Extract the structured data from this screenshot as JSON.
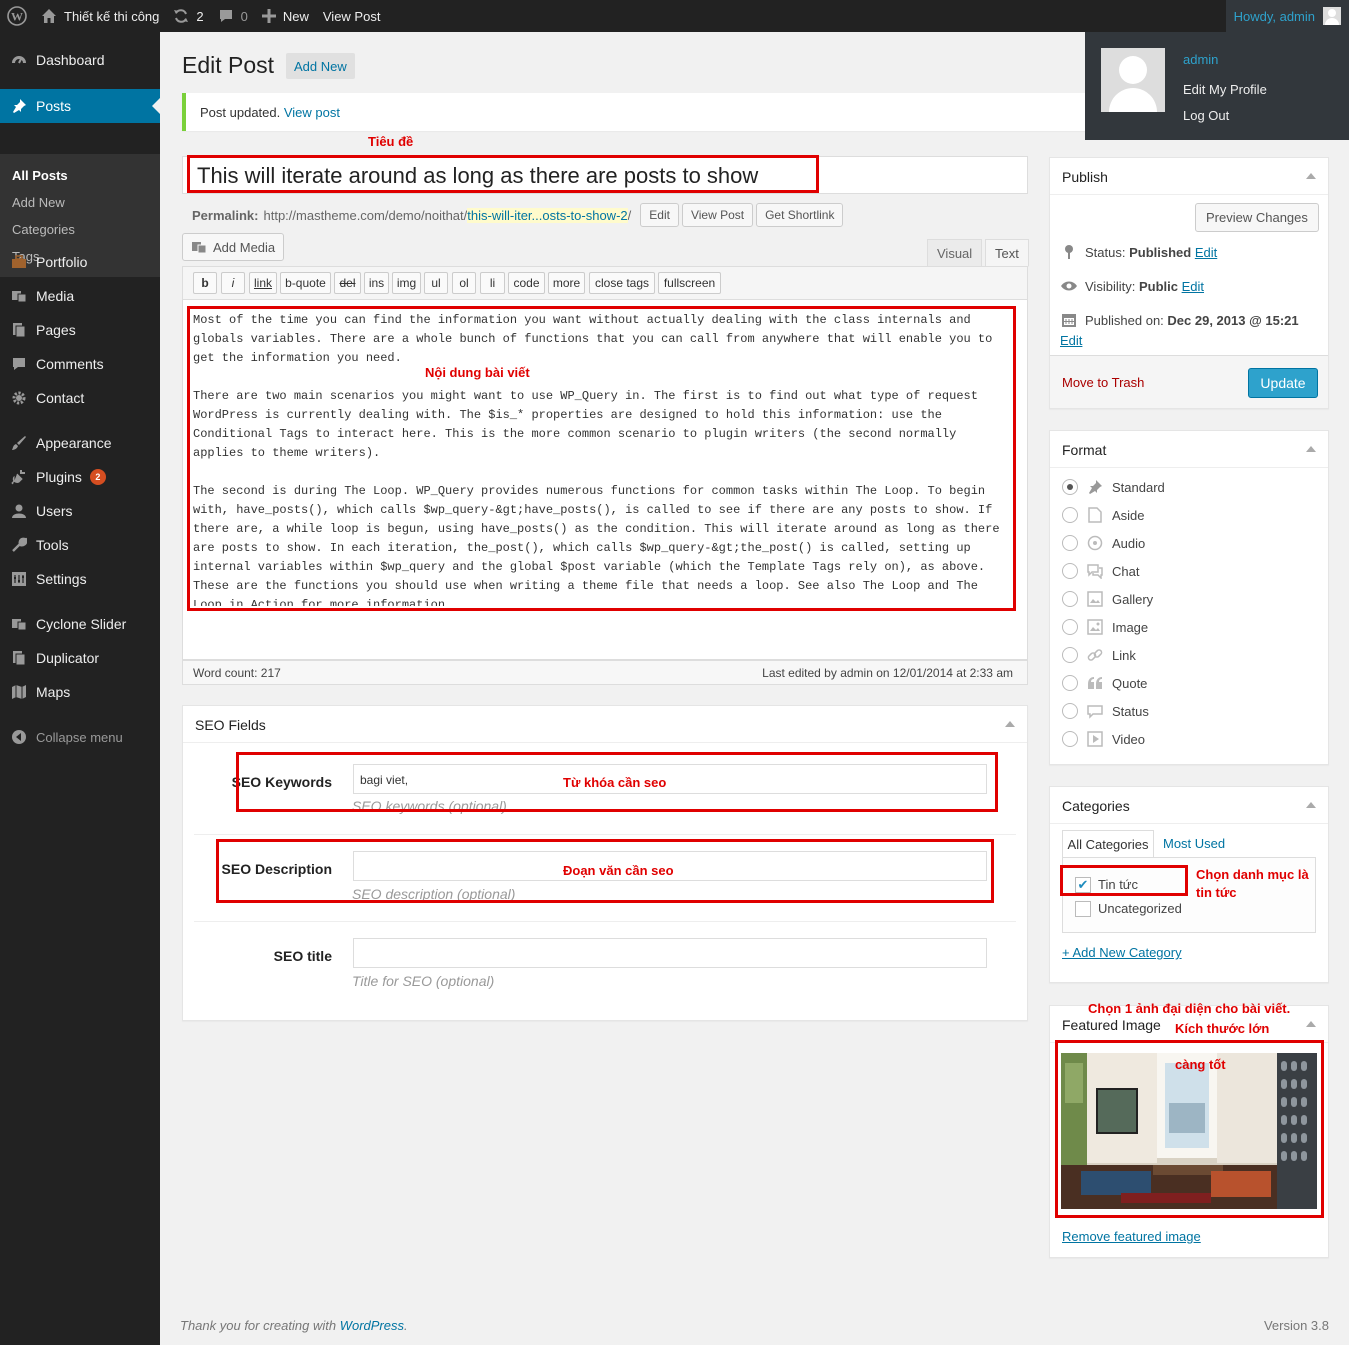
{
  "adminbar": {
    "site_name": "Thiết kế thi công",
    "updates_count": "2",
    "comments_count": "0",
    "new_label": "New",
    "view_post_label": "View Post",
    "howdy": "Howdy, admin"
  },
  "user_menu": {
    "username": "admin",
    "edit_profile": "Edit My Profile",
    "logout": "Log Out"
  },
  "sidebar": {
    "items": [
      {
        "label": "Dashboard",
        "icon": "dashboard-icon"
      },
      {
        "label": "Posts",
        "icon": "pin-icon"
      },
      {
        "label": "Portfolio",
        "icon": "briefcase-icon"
      },
      {
        "label": "Media",
        "icon": "media-icon"
      },
      {
        "label": "Pages",
        "icon": "pages-icon"
      },
      {
        "label": "Comments",
        "icon": "comment-icon"
      },
      {
        "label": "Contact",
        "icon": "gear-icon"
      },
      {
        "label": "Appearance",
        "icon": "brush-icon"
      },
      {
        "label": "Plugins",
        "icon": "plug-icon",
        "badge": "2"
      },
      {
        "label": "Users",
        "icon": "user-icon"
      },
      {
        "label": "Tools",
        "icon": "wrench-icon"
      },
      {
        "label": "Settings",
        "icon": "settings-icon"
      },
      {
        "label": "Cyclone Slider",
        "icon": "media-icon"
      },
      {
        "label": "Duplicator",
        "icon": "pages-icon"
      },
      {
        "label": "Maps",
        "icon": "map-icon"
      }
    ],
    "submenu": [
      "All Posts",
      "Add New",
      "Categories",
      "Tags"
    ],
    "collapse": "Collapse menu"
  },
  "page": {
    "title": "Edit Post",
    "add_new": "Add New",
    "notice_text": "Post updated.",
    "notice_link": "View post"
  },
  "annotations": {
    "title": "Tiêu đề",
    "content": "Nội dung bài viết",
    "keywords": "Từ khóa cần seo",
    "description": "Đoạn văn cần seo",
    "category_line1": "Chọn danh mục là",
    "category_line2": "tin tức",
    "image_line1": "Chọn 1 ảnh đại diện cho bài viết.",
    "image_line2": "Kích thước lớn",
    "image_line3": "càng tốt"
  },
  "post": {
    "title": "This will iterate around as long as there are posts to show",
    "permalink_label": "Permalink:",
    "permalink_base": "http://mastheme.com/demo/noithat/",
    "permalink_slug": "this-will-iter...osts-to-show-2",
    "permalink_end": "/",
    "edit_btn": "Edit",
    "view_btn": "View Post",
    "shortlink_btn": "Get Shortlink",
    "add_media": "Add Media",
    "tab_visual": "Visual",
    "tab_text": "Text",
    "quicktags": [
      "b",
      "i",
      "link",
      "b-quote",
      "del",
      "ins",
      "img",
      "ul",
      "ol",
      "li",
      "code",
      "more",
      "close tags",
      "fullscreen"
    ],
    "content_p1": "Most of the time you can find the information you want without actually dealing with the class internals and globals variables. There are a whole bunch of functions that you can call from anywhere that will enable you to get the information you need.",
    "content_p2": "There are two main scenarios you might want to use WP_Query in. The first is to find out what type of request WordPress is currently dealing with. The $is_* properties are designed to hold this information: use the Conditional Tags to interact here. This is the more common scenario to plugin writers (the second normally applies to theme writers).",
    "content_p3": "The second is during The Loop. WP_Query provides numerous functions for common tasks within The Loop. To begin with, have_posts(), which calls $wp_query-&gt;have_posts(), is called to see if there are any posts to show. If there are, a while loop is begun, using have_posts() as the condition. This will iterate around as long as there are posts to show. In each iteration, the_post(), which calls $wp_query-&gt;the_post() is called, setting up internal variables within $wp_query and the global $post variable (which the Template Tags rely on), as above. These are the functions you should use when writing a theme file that needs a loop. See also The Loop and The Loop in Action for more information.",
    "word_count": "Word count: 217",
    "last_edited": "Last edited by admin on 12/01/2014 at 2:33 am"
  },
  "seo": {
    "heading": "SEO Fields",
    "keywords_label": "SEO Keywords",
    "keywords_value": "bagi viet,",
    "keywords_hint": "SEO keywords (optional)",
    "description_label": "SEO Description",
    "description_value": "",
    "description_hint": "SEO description (optional)",
    "title_label": "SEO title",
    "title_value": "",
    "title_hint": "Title for SEO (optional)"
  },
  "publish": {
    "heading": "Publish",
    "preview": "Preview Changes",
    "status_label": "Status:",
    "status_value": "Published",
    "visibility_label": "Visibility:",
    "visibility_value": "Public",
    "published_label": "Published on:",
    "published_value": "Dec 29, 2013 @ 15:21",
    "edit": "Edit",
    "trash": "Move to Trash",
    "update": "Update"
  },
  "format": {
    "heading": "Format",
    "selected": "Standard",
    "options": [
      {
        "label": "Standard",
        "icon": "pin-icon"
      },
      {
        "label": "Aside",
        "icon": "aside-icon"
      },
      {
        "label": "Audio",
        "icon": "audio-icon"
      },
      {
        "label": "Chat",
        "icon": "chat-icon"
      },
      {
        "label": "Gallery",
        "icon": "gallery-icon"
      },
      {
        "label": "Image",
        "icon": "image-icon"
      },
      {
        "label": "Link",
        "icon": "link-icon"
      },
      {
        "label": "Quote",
        "icon": "quote-icon"
      },
      {
        "label": "Status",
        "icon": "status-icon"
      },
      {
        "label": "Video",
        "icon": "video-icon"
      }
    ]
  },
  "categories": {
    "heading": "Categories",
    "tab_all": "All Categories",
    "tab_used": "Most Used",
    "items": [
      {
        "label": "Tin tức",
        "checked": true
      },
      {
        "label": "Uncategorized",
        "checked": false
      }
    ],
    "add_new": "+ Add New Category"
  },
  "featured": {
    "heading": "Featured Image",
    "remove": "Remove featured image"
  },
  "footer": {
    "thanks": "Thank you for creating with ",
    "wp_link": "WordPress",
    "period": ".",
    "version": "Version 3.8"
  },
  "colors": {
    "accent": "#0074a2",
    "annotation": "#e00000",
    "sidebar": "#222222"
  }
}
